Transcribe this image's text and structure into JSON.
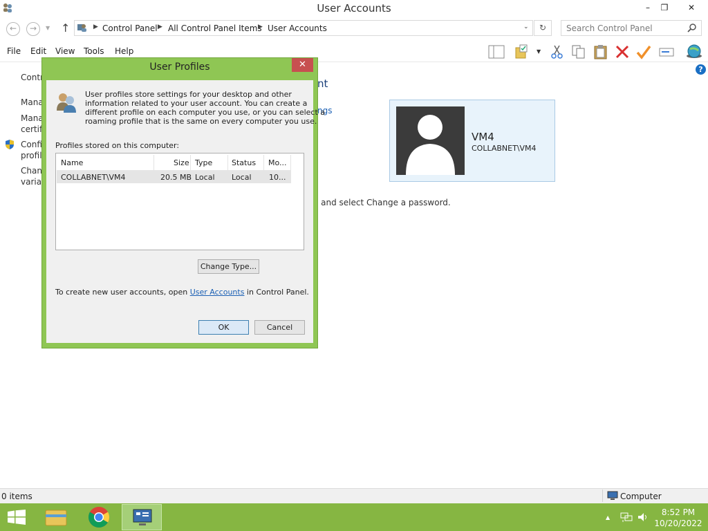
{
  "window": {
    "title": "User Accounts",
    "min_glyph": "–",
    "max_glyph": "❐",
    "close_glyph": "✕"
  },
  "address": {
    "crumbs": [
      "Control Panel",
      "All Control Panel Items",
      "User Accounts"
    ],
    "search_placeholder": "Search Control Panel"
  },
  "menu": [
    "File",
    "Edit",
    "View",
    "Tools",
    "Help"
  ],
  "background": {
    "left_items": [
      "Contr",
      "Mana",
      "Mana",
      "certifi",
      "Confi",
      "profile",
      "Chang",
      "variab"
    ],
    "heading_fragment": "nt",
    "link_fragment": "ngs",
    "instruction_fragment": "l and select Change a password."
  },
  "user_card": {
    "name": "VM4",
    "account": "COLLABNET\\VM4"
  },
  "dialog": {
    "title": "User Profiles",
    "close_glyph": "✕",
    "intro": [
      "User profiles store settings for your desktop and other",
      "information related to your user account. You can create a",
      "different profile on each computer you use, or you can select a",
      "roaming profile that is the same on every computer you use."
    ],
    "profiles_label": "Profiles stored on this computer:",
    "columns": [
      "Name",
      "Size",
      "Type",
      "Status",
      "Mo..."
    ],
    "rows": [
      {
        "name": "COLLABNET\\VM4",
        "size": "20.5 MB",
        "type": "Local",
        "status": "Local",
        "modified": "10..."
      }
    ],
    "change_type_button": "Change Type...",
    "footer_before": "To create new user accounts, open ",
    "footer_link": "User Accounts",
    "footer_after": " in Control Panel.",
    "ok_button": "OK",
    "cancel_button": "Cancel"
  },
  "status_bar": {
    "items": "0 items",
    "location": "Computer"
  },
  "taskbar": {
    "time": "8:52 PM",
    "date": "10/20/2022"
  },
  "colors": {
    "dialog_frame": "#8fc654",
    "taskbar": "#86b642",
    "close_red": "#c75050",
    "link_blue": "#1a5fb4"
  }
}
